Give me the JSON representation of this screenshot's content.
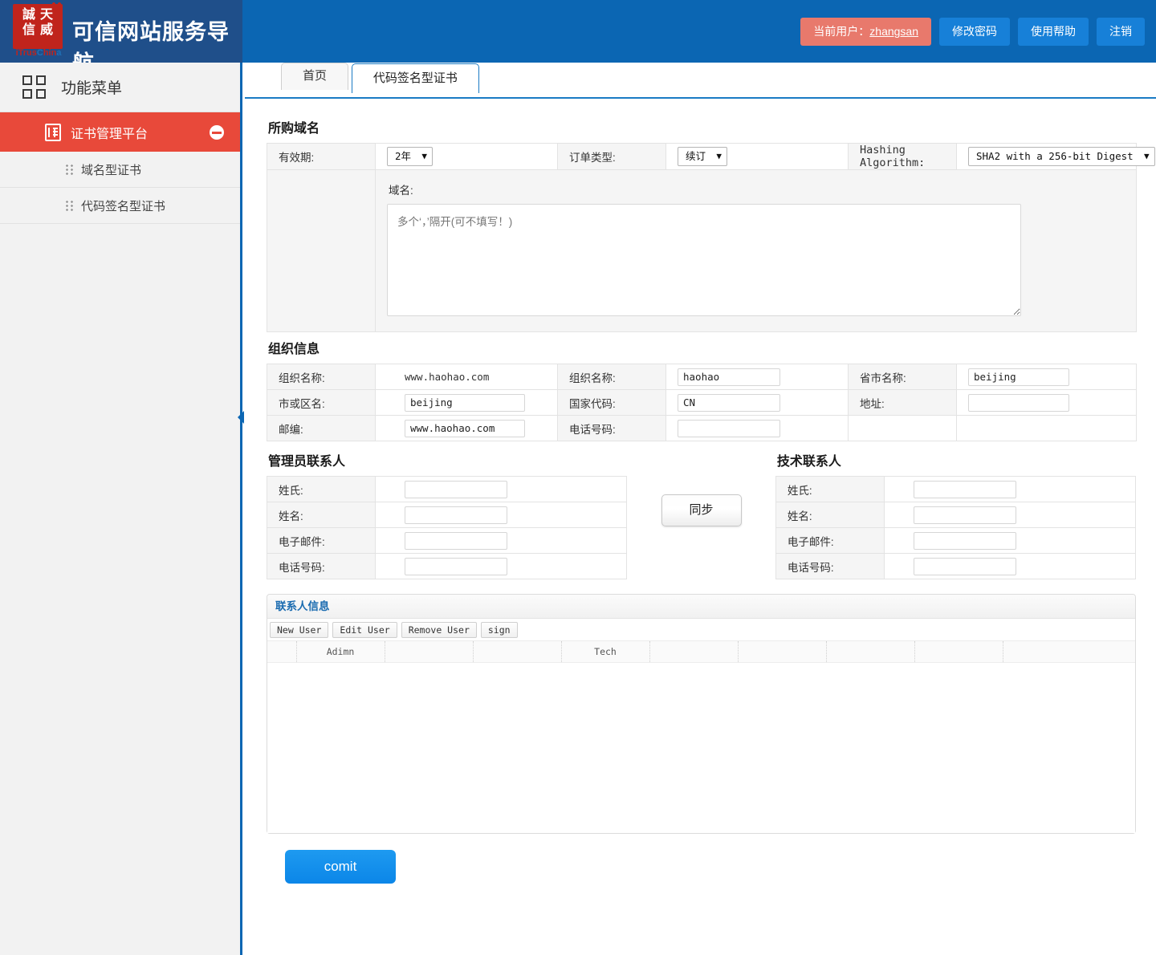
{
  "header": {
    "brand_logo_line1": "誠天",
    "brand_logo_line2": "信威",
    "brand_sub_red1": "iTrus",
    "brand_sub_blue": "C",
    "brand_sub_red2": "hin",
    "brand_sub_blue2": "a",
    "title": "可信网站服务导航",
    "current_user_label": "当前用户：",
    "current_user": "zhangsan",
    "change_password": "修改密码",
    "help": "使用帮助",
    "logout": "注销"
  },
  "sidebar": {
    "menu_title": "功能菜单",
    "group_label": "证书管理平台",
    "items": [
      {
        "label": "域名型证书"
      },
      {
        "label": "代码签名型证书"
      }
    ]
  },
  "tabs": [
    {
      "label": "首页",
      "active": false
    },
    {
      "label": "代码签名型证书",
      "active": true
    }
  ],
  "domain_section": {
    "title": "所购域名",
    "validity_label": "有效期:",
    "validity_value": "2年",
    "order_type_label": "订单类型:",
    "order_type_value": "续订",
    "hashing_label": "Hashing Algorithm:",
    "hashing_value": "SHA2 with a 256-bit Digest",
    "domain_label": "域名:",
    "domain_placeholder": "多个‘，’隔开(可不填写！)",
    "domain_value": ""
  },
  "org_section": {
    "title": "组织信息",
    "rows": [
      {
        "l1": "组织名称:",
        "v1": "www.haohao.com",
        "v1_input": false,
        "l2": "组织名称:",
        "v2": "haohao",
        "l3": "省市名称:",
        "v3": "beijing"
      },
      {
        "l1": "市或区名:",
        "v1": "beijing",
        "v1_input": true,
        "l2": "国家代码:",
        "v2": "CN",
        "l3": "地址:",
        "v3": ""
      },
      {
        "l1": "邮编:",
        "v1": "www.haohao.com",
        "v1_input": true,
        "l2": "电话号码:",
        "v2": "",
        "l3": "",
        "v3": null
      }
    ]
  },
  "admin_contact": {
    "title": "管理员联系人",
    "fields": [
      {
        "label": "姓氏:",
        "value": ""
      },
      {
        "label": "姓名:",
        "value": ""
      },
      {
        "label": "电子邮件:",
        "value": ""
      },
      {
        "label": "电话号码:",
        "value": ""
      }
    ]
  },
  "tech_contact": {
    "title": "技术联系人",
    "fields": [
      {
        "label": "姓氏:",
        "value": ""
      },
      {
        "label": "姓名:",
        "value": ""
      },
      {
        "label": "电子邮件:",
        "value": ""
      },
      {
        "label": "电话号码:",
        "value": ""
      }
    ]
  },
  "sync_button": "同步",
  "contact_panel": {
    "title": "联系人信息",
    "buttons": [
      "New User",
      "Edit User",
      "Remove User",
      "sign"
    ],
    "columns": [
      "",
      "Adimn",
      "",
      "",
      "Tech",
      "",
      "",
      "",
      "",
      ""
    ],
    "rows": []
  },
  "commit_button": "comit"
}
